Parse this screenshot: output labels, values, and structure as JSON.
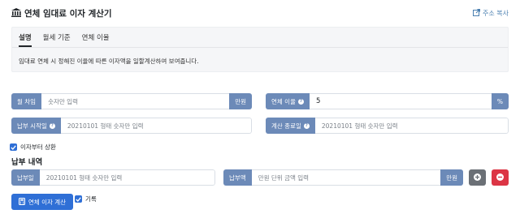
{
  "header": {
    "title": "연체 임대료 이자 계산기",
    "copy_label": "주소 복사"
  },
  "tabs": [
    "설명",
    "월세 기준",
    "연체 이율"
  ],
  "description": "임대료 연체 시 정해진 이율에 따른 이자액을 일할계산하여 보여줍니다.",
  "form": {
    "monthly_rent": {
      "label": "월 차임",
      "placeholder": "숫자만 입력",
      "unit": "만원"
    },
    "overdue_rate": {
      "label": "연체 이율",
      "value": "5",
      "unit": "%"
    },
    "due_start": {
      "label": "납부 시작일",
      "placeholder": "20210101 형태 숫자만 입력"
    },
    "calc_end": {
      "label": "계산 종료일",
      "placeholder": "20210101 형태 숫자만 입력"
    },
    "interest_first": {
      "label": "이자부터 상환",
      "checked": true
    }
  },
  "payments": {
    "title": "납부 내역",
    "date": {
      "label": "납부일",
      "placeholder": "20210101 형태 숫자만 입력"
    },
    "amount": {
      "label": "납부액",
      "placeholder": "만원 단위 금액 입력",
      "unit": "만원"
    }
  },
  "actions": {
    "calculate_label": "연체 이자 계산",
    "record_label": "기록",
    "record_checked": true
  },
  "colors": {
    "addon": "#6c8ab8",
    "primary": "#2f6fd6",
    "danger": "#dc3545",
    "secondary": "#6b7076"
  }
}
